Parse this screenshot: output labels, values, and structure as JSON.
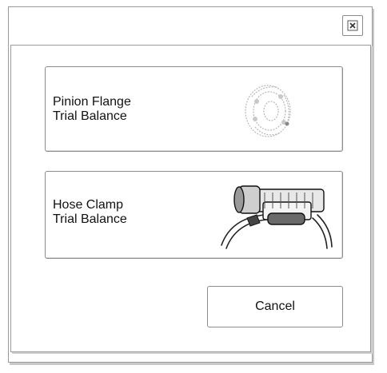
{
  "dialog": {
    "close_icon": "close-icon",
    "options": [
      {
        "line1": "Pinion Flange",
        "line2": "Trial Balance",
        "icon": "pinion-flange-icon"
      },
      {
        "line1": "Hose Clamp",
        "line2": "Trial Balance",
        "icon": "hose-clamp-icon"
      }
    ],
    "cancel_label": "Cancel"
  }
}
